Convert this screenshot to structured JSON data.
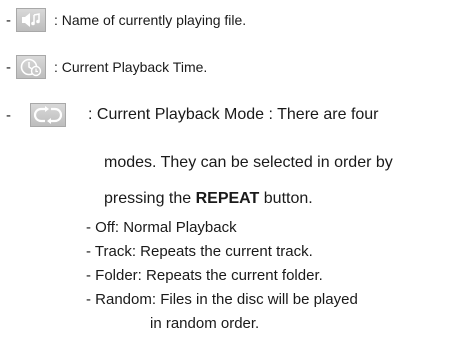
{
  "items": [
    {
      "bullet": "-",
      "icon": "speaker-note-icon",
      "text": ": Name of currently playing file."
    },
    {
      "bullet": "-",
      "icon": "clock-icon",
      "text": ": Current Playback Time."
    },
    {
      "bullet": "-",
      "icon": "repeat-loop-icon",
      "text": ": Current Playback Mode : There are four"
    }
  ],
  "paragraph": {
    "line1": "modes. They can be selected in order by",
    "line2_pre": "pressing the ",
    "line2_bold": "REPEAT",
    "line2_post": " button."
  },
  "modes": [
    "- Off: Normal Playback",
    "- Track: Repeats the current track.",
    "- Folder: Repeats the current folder.",
    "- Random: Files in the disc will be played"
  ],
  "modes_continuation": "in random order.",
  "colors": {
    "icon_bg": "#c8c8c8",
    "text": "#1a1a1a"
  }
}
